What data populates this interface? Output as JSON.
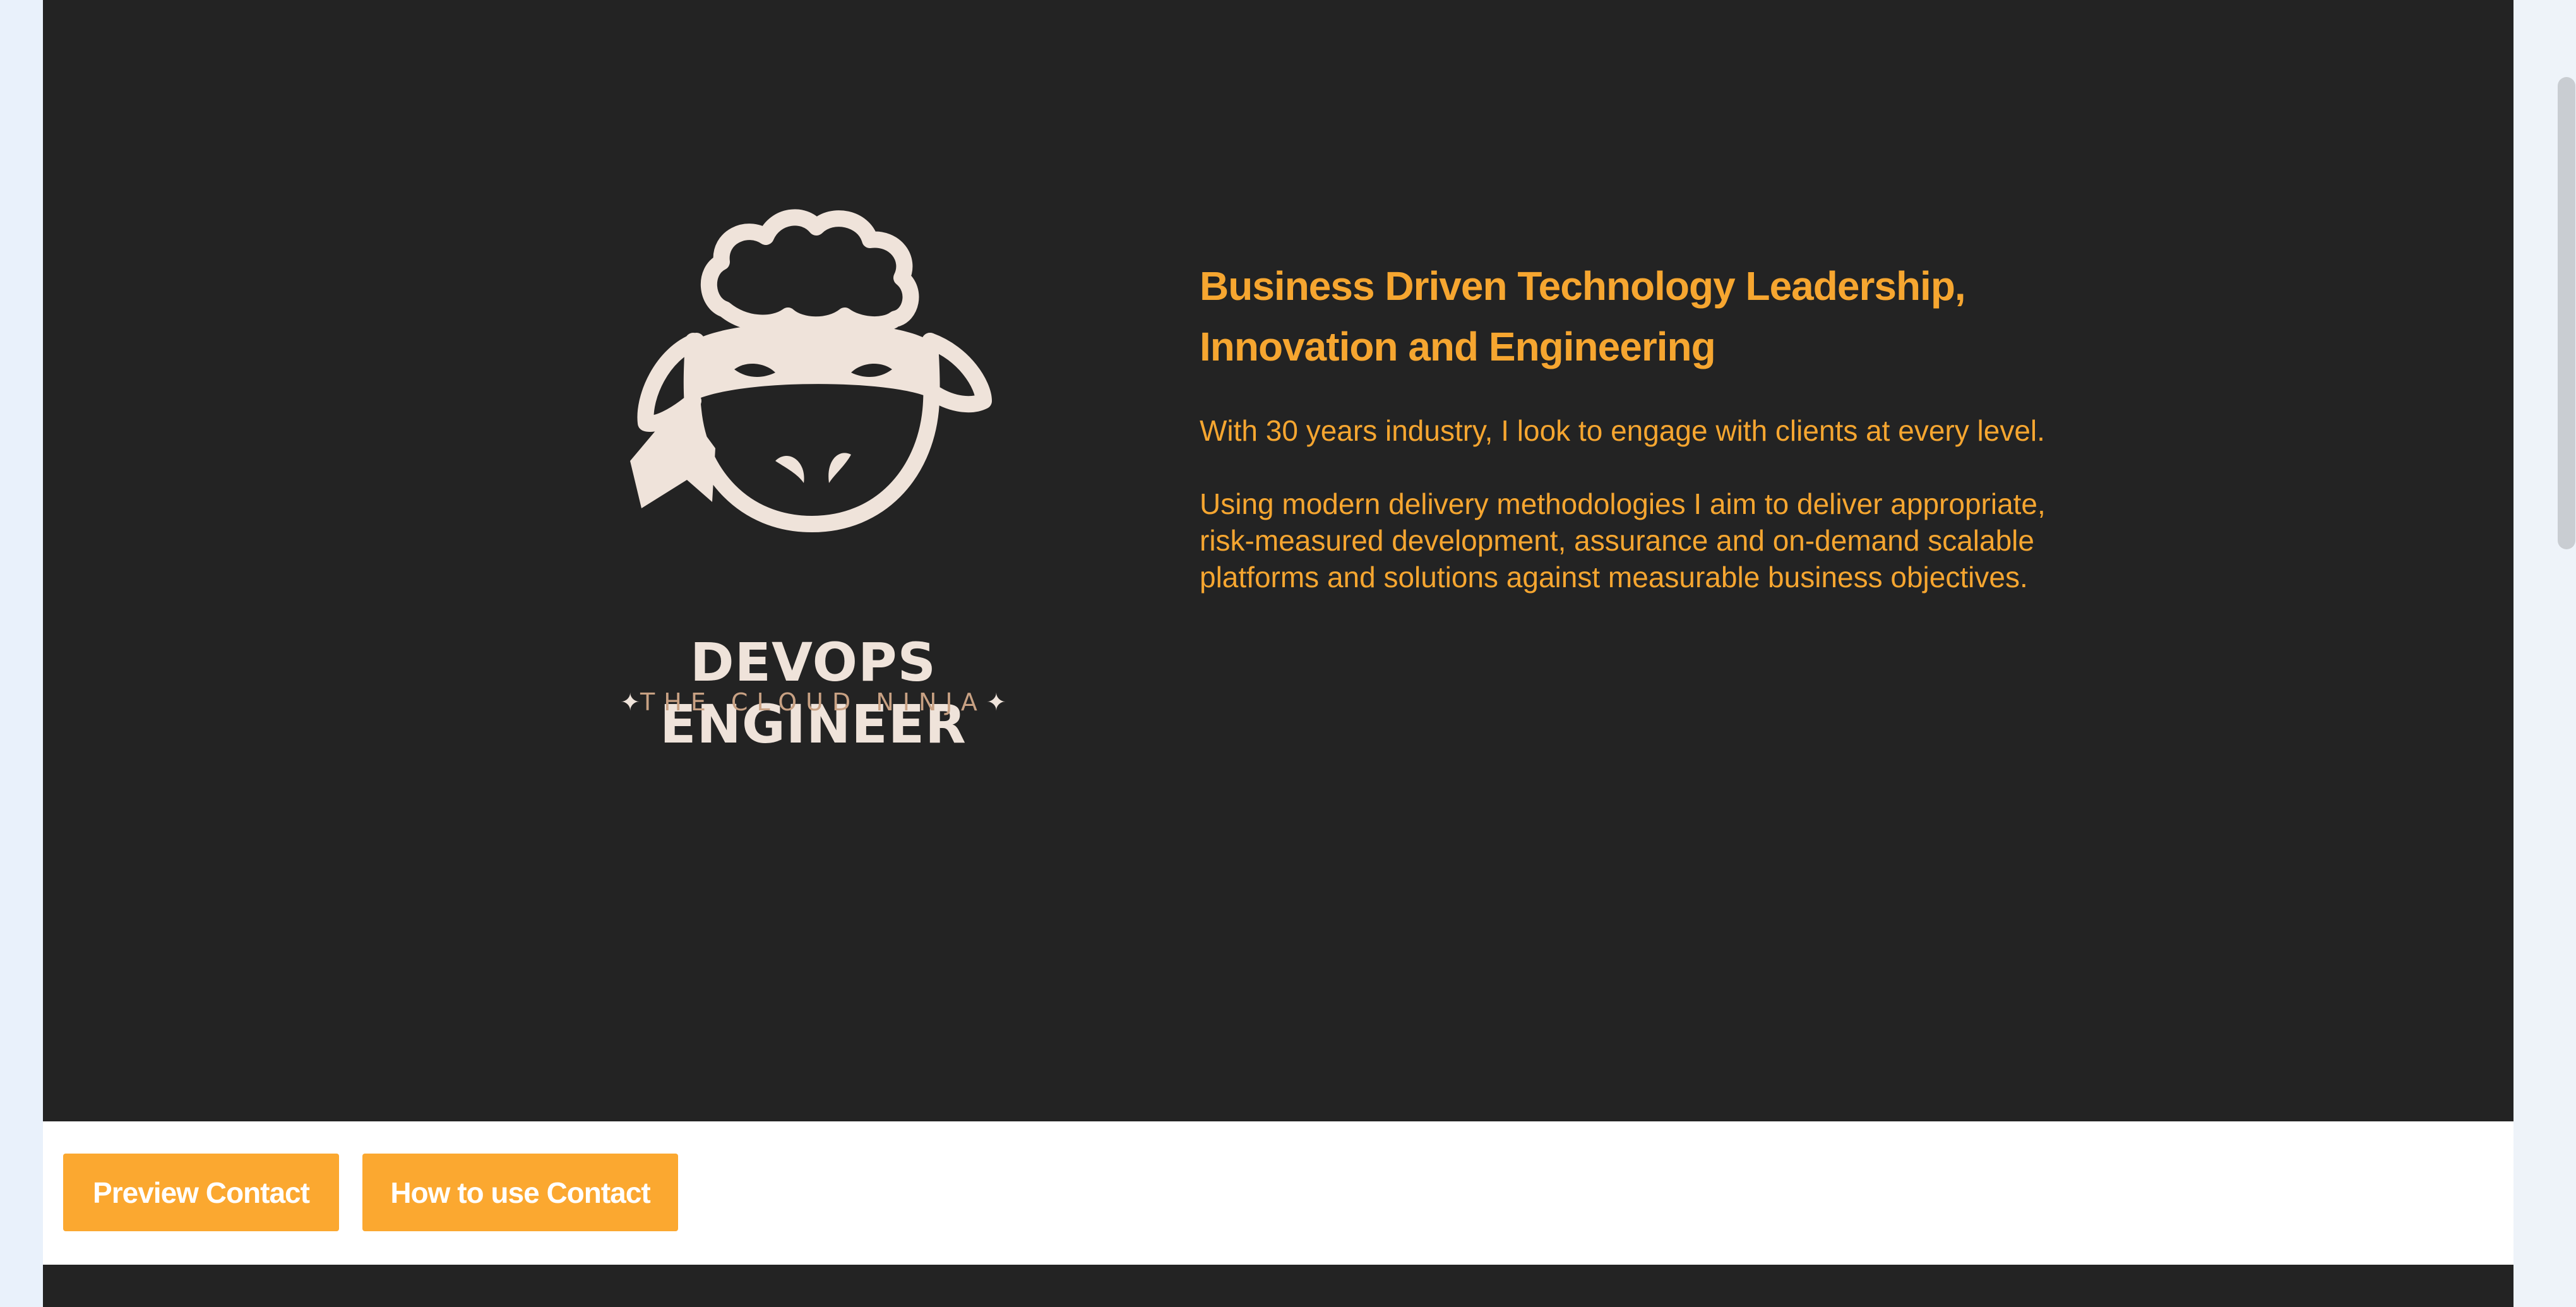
{
  "hero": {
    "logo": {
      "title": "DEVOPS ENGINEER",
      "subtitle": "THE CLOUD NINJA",
      "icon": "ninja-sheep-logo-icon",
      "colors": {
        "cream": "#efe3da",
        "tan": "#c8a183"
      }
    },
    "heading": "Business Driven Technology Leadership, Innovation and Engineering",
    "paragraph_1": "With 30 years industry, I look to engage with clients at every level.",
    "paragraph_2": "Using modern delivery methodologies I aim to deliver appropriate, risk-measured development, assurance and on-demand scalable platforms and solutions against measurable business objectives."
  },
  "actions": {
    "preview_label": "Preview Contact",
    "howto_label": "How to use Contact"
  },
  "colors": {
    "hero_bg": "#232323",
    "accent": "#f6a630",
    "button_bg": "#fba830",
    "page_bg": "#ffffff"
  }
}
